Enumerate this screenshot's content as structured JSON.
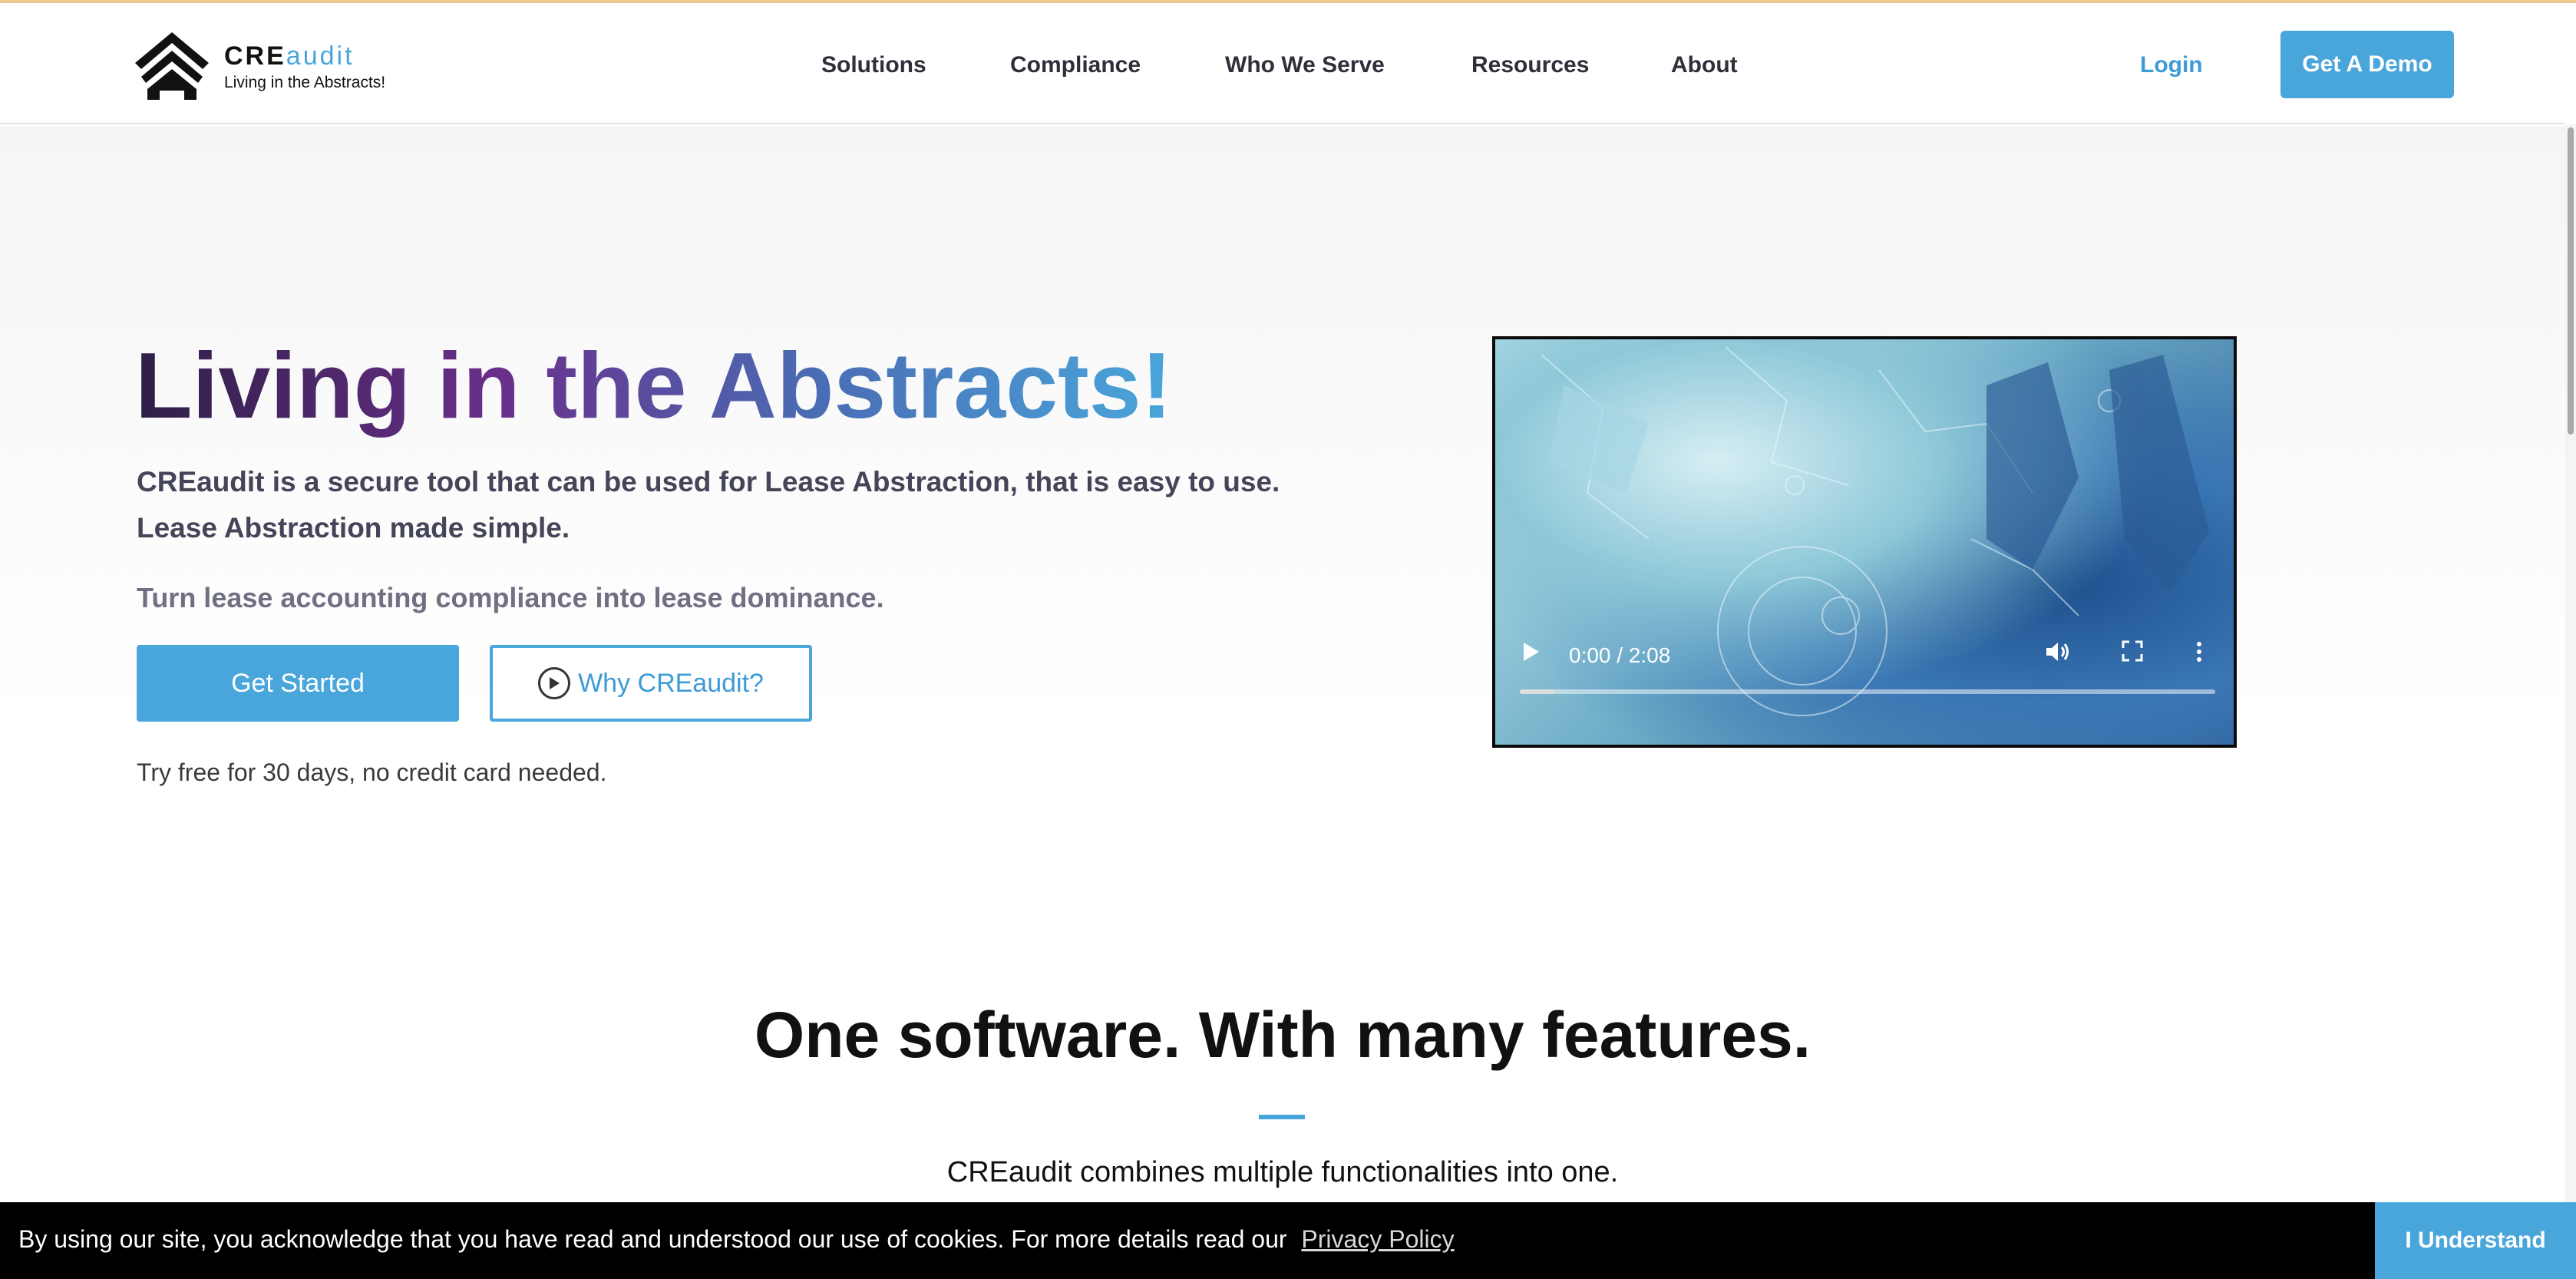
{
  "brand": {
    "name_bold": "CRE",
    "name_light": "audit",
    "tagline": "Living in the Abstracts!",
    "accent_color": "#49a6db"
  },
  "nav": {
    "items": [
      {
        "label": "Solutions"
      },
      {
        "label": "Compliance"
      },
      {
        "label": "Who We Serve"
      },
      {
        "label": "Resources"
      },
      {
        "label": "About"
      }
    ],
    "login_label": "Login",
    "demo_label": "Get A Demo"
  },
  "hero": {
    "title": "Living in the Abstracts!",
    "description": "CREaudit is a secure tool that can be used for Lease Abstraction, that is easy to use. Lease Abstraction made simple.",
    "subtitle": "Turn lease accounting compliance into lease dominance.",
    "get_started_label": "Get Started",
    "why_label": "Why CREaudit?",
    "trial_note": "Try free for 30 days, no credit card needed."
  },
  "video": {
    "time": "0:00 / 2:08",
    "progress": 0.05,
    "icons": [
      "play-icon",
      "volume-icon",
      "fullscreen-icon",
      "more-options-icon"
    ]
  },
  "features": {
    "title": "One software. With many features.",
    "subtitle": "CREaudit combines multiple functionalities into one."
  },
  "cookie": {
    "text": "By using our site, you acknowledge that you have read and understood our use of cookies. For more details read our",
    "link_label": "Privacy Policy",
    "accept_label": "I Understand"
  }
}
